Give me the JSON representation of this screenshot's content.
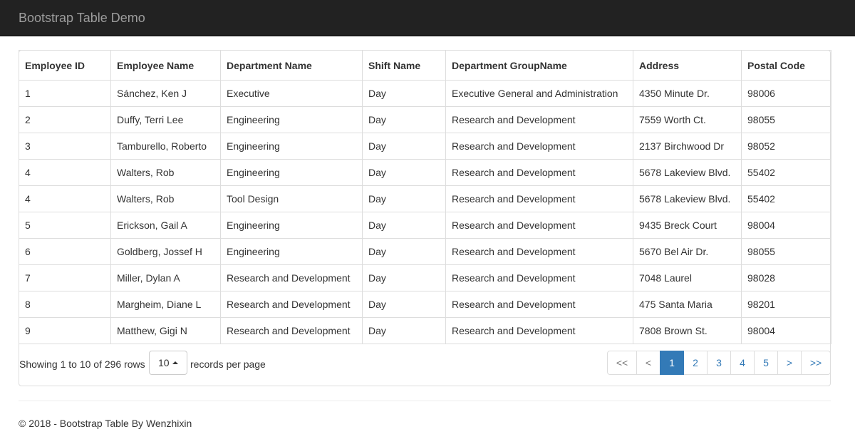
{
  "navbar": {
    "brand": "Bootstrap Table Demo"
  },
  "table": {
    "columns": [
      "Employee ID",
      "Employee Name",
      "Department Name",
      "Shift Name",
      "Department GroupName",
      "Address",
      "Postal Code"
    ],
    "rows": [
      [
        "1",
        "Sánchez, Ken J",
        "Executive",
        "Day",
        "Executive General and Administration",
        "4350 Minute Dr.",
        "98006"
      ],
      [
        "2",
        "Duffy, Terri Lee",
        "Engineering",
        "Day",
        "Research and Development",
        "7559 Worth Ct.",
        "98055"
      ],
      [
        "3",
        "Tamburello, Roberto",
        "Engineering",
        "Day",
        "Research and Development",
        "2137 Birchwood Dr",
        "98052"
      ],
      [
        "4",
        "Walters, Rob",
        "Engineering",
        "Day",
        "Research and Development",
        "5678 Lakeview Blvd.",
        "55402"
      ],
      [
        "4",
        "Walters, Rob",
        "Tool Design",
        "Day",
        "Research and Development",
        "5678 Lakeview Blvd.",
        "55402"
      ],
      [
        "5",
        "Erickson, Gail A",
        "Engineering",
        "Day",
        "Research and Development",
        "9435 Breck Court",
        "98004"
      ],
      [
        "6",
        "Goldberg, Jossef H",
        "Engineering",
        "Day",
        "Research and Development",
        "5670 Bel Air Dr.",
        "98055"
      ],
      [
        "7",
        "Miller, Dylan A",
        "Research and Development",
        "Day",
        "Research and Development",
        "7048 Laurel",
        "98028"
      ],
      [
        "8",
        "Margheim, Diane L",
        "Research and Development",
        "Day",
        "Research and Development",
        "475 Santa Maria",
        "98201"
      ],
      [
        "9",
        "Matthew, Gigi N",
        "Research and Development",
        "Day",
        "Research and Development",
        "7808 Brown St.",
        "98004"
      ]
    ]
  },
  "pagination": {
    "showing_text": "Showing 1 to 10 of 296 rows",
    "page_size": "10",
    "per_page_text": "records per page",
    "pages": [
      {
        "label": "<<",
        "state": "disabled"
      },
      {
        "label": "<",
        "state": "disabled"
      },
      {
        "label": "1",
        "state": "active"
      },
      {
        "label": "2",
        "state": "normal"
      },
      {
        "label": "3",
        "state": "normal"
      },
      {
        "label": "4",
        "state": "normal"
      },
      {
        "label": "5",
        "state": "normal"
      },
      {
        "label": ">",
        "state": "normal"
      },
      {
        "label": ">>",
        "state": "normal"
      }
    ]
  },
  "footer": {
    "text": "© 2018 - Bootstrap Table By Wenzhixin"
  },
  "colors": {
    "navbar_bg": "#222222",
    "brand_text": "#9d9d9d",
    "link": "#337ab7",
    "active_page": "#337ab7",
    "border": "#dddddd"
  }
}
